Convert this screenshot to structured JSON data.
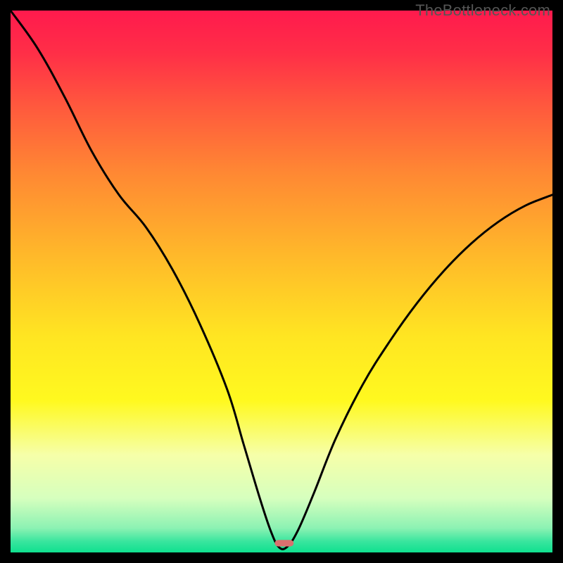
{
  "watermark": "TheBottleneck.com",
  "gradient": {
    "stops": [
      {
        "offset": 0.0,
        "color": "#ff1a4d"
      },
      {
        "offset": 0.08,
        "color": "#ff2f47"
      },
      {
        "offset": 0.18,
        "color": "#ff5a3d"
      },
      {
        "offset": 0.3,
        "color": "#ff8833"
      },
      {
        "offset": 0.45,
        "color": "#ffb82a"
      },
      {
        "offset": 0.6,
        "color": "#ffe522"
      },
      {
        "offset": 0.72,
        "color": "#fff91f"
      },
      {
        "offset": 0.82,
        "color": "#f6ffa9"
      },
      {
        "offset": 0.9,
        "color": "#d6ffbe"
      },
      {
        "offset": 0.955,
        "color": "#8cf2b3"
      },
      {
        "offset": 0.98,
        "color": "#38e59e"
      },
      {
        "offset": 1.0,
        "color": "#0fe08f"
      }
    ]
  },
  "marker": {
    "x_frac": 0.505,
    "y_frac": 0.983,
    "width_frac": 0.035,
    "height_frac": 0.012,
    "color": "#d9706f"
  },
  "chart_data": {
    "type": "line",
    "title": "",
    "xlabel": "",
    "ylabel": "",
    "xlim": [
      0,
      1
    ],
    "ylim": [
      0,
      1
    ],
    "series": [
      {
        "name": "bottleneck-curve",
        "x": [
          0.0,
          0.05,
          0.1,
          0.15,
          0.2,
          0.25,
          0.3,
          0.35,
          0.4,
          0.43,
          0.46,
          0.48,
          0.495,
          0.51,
          0.53,
          0.56,
          0.6,
          0.65,
          0.7,
          0.75,
          0.8,
          0.85,
          0.9,
          0.95,
          1.0
        ],
        "y": [
          1.0,
          0.93,
          0.84,
          0.74,
          0.66,
          0.6,
          0.52,
          0.42,
          0.3,
          0.2,
          0.1,
          0.04,
          0.01,
          0.01,
          0.04,
          0.11,
          0.21,
          0.31,
          0.39,
          0.46,
          0.52,
          0.57,
          0.61,
          0.64,
          0.66
        ]
      }
    ],
    "annotations": []
  }
}
